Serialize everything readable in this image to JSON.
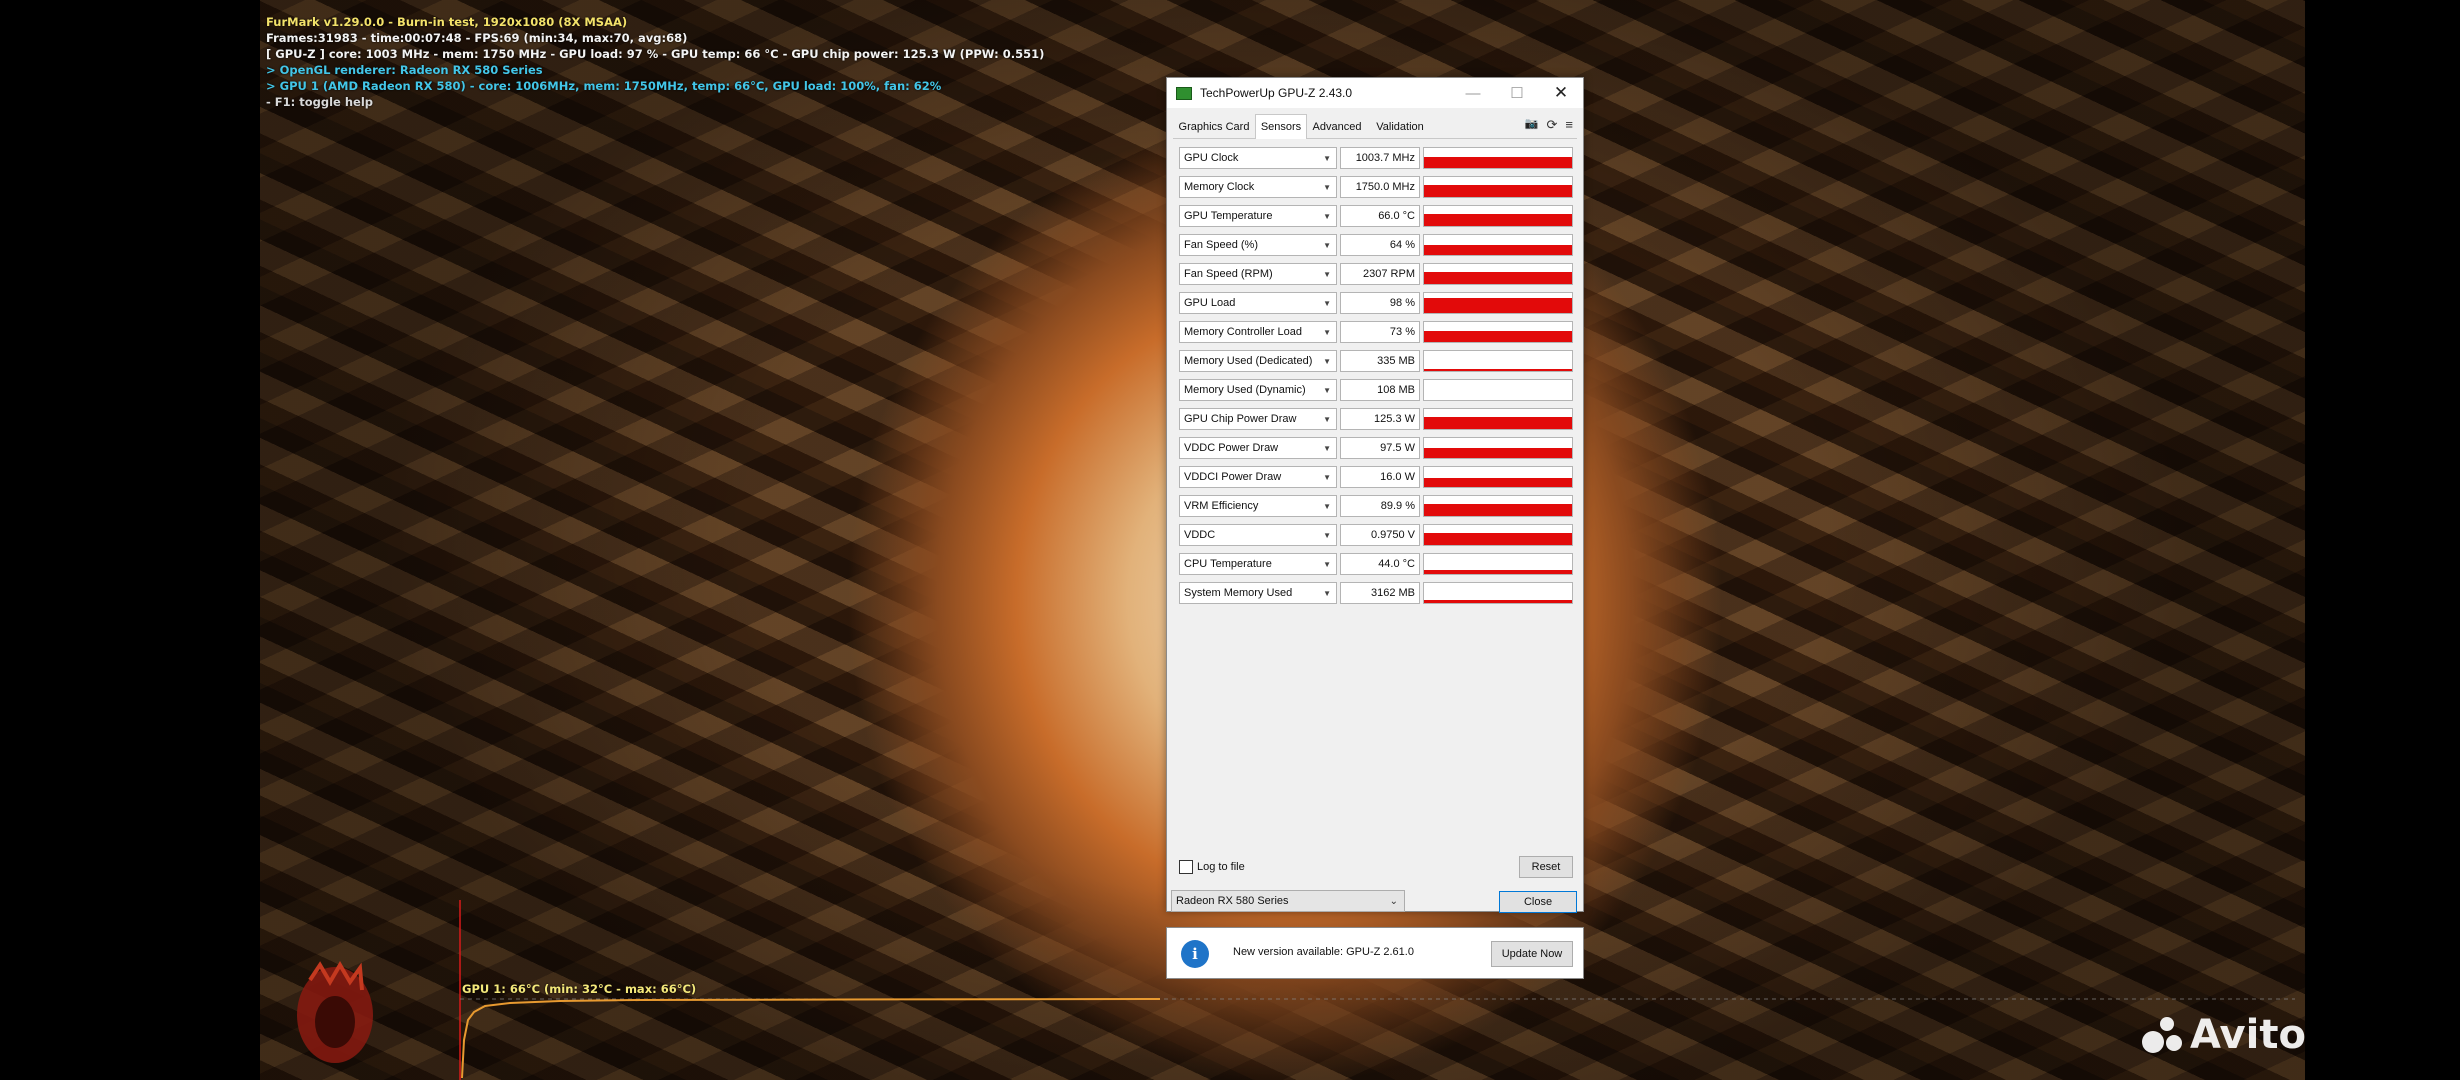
{
  "furmark": {
    "line1": "FurMark v1.29.0.0 - Burn-in test, 1920x1080 (8X MSAA)",
    "line2": "Frames:31983 - time:00:07:48 - FPS:69 (min:34, max:70, avg:68)",
    "line3": "[ GPU-Z ] core: 1003 MHz - mem: 1750 MHz - GPU load: 97 % - GPU temp: 66 °C - GPU chip power: 125.3 W (PPW: 0.551)",
    "line4": "> OpenGL renderer: Radeon RX 580 Series",
    "line5": "> GPU 1 (AMD Radeon RX 580) - core: 1006MHz, mem: 1750MHz, temp: 66°C, GPU load: 100%, fan: 62%",
    "line6": "- F1: toggle help",
    "graph_label": "GPU 1: 66°C (min: 32°C - max: 66°C)"
  },
  "gpuz": {
    "title": "TechPowerUp GPU-Z 2.43.0",
    "min_glyph": "—",
    "max_glyph": "☐",
    "close_glyph": "✕",
    "tabs": [
      {
        "label": "Graphics Card"
      },
      {
        "label": "Sensors"
      },
      {
        "label": "Advanced"
      },
      {
        "label": "Validation"
      }
    ],
    "icons": {
      "camera": "📷",
      "refresh": "⟳",
      "menu": "≡"
    },
    "sensors": [
      {
        "name": "GPU Clock",
        "value": "1003.7 MHz",
        "level": 0.55
      },
      {
        "name": "Memory Clock",
        "value": "1750.0 MHz",
        "level": 0.62
      },
      {
        "name": "GPU Temperature",
        "value": "66.0 °C",
        "level": 0.62
      },
      {
        "name": "Fan Speed (%)",
        "value": "64 %",
        "level": 0.5
      },
      {
        "name": "Fan Speed (RPM)",
        "value": "2307 RPM",
        "level": 0.6
      },
      {
        "name": "GPU Load",
        "value": "98 %",
        "level": 0.75
      },
      {
        "name": "Memory Controller Load",
        "value": "73 %",
        "level": 0.55
      },
      {
        "name": "Memory Used (Dedicated)",
        "value": "335 MB",
        "level": 0.08
      },
      {
        "name": "Memory Used (Dynamic)",
        "value": "108 MB",
        "level": 0.0
      },
      {
        "name": "GPU Chip Power Draw",
        "value": "125.3 W",
        "level": 0.6
      },
      {
        "name": "VDDC Power Draw",
        "value": "97.5 W",
        "level": 0.5
      },
      {
        "name": "VDDCI Power Draw",
        "value": "16.0 W",
        "level": 0.45
      },
      {
        "name": "VRM Efficiency",
        "value": "89.9 %",
        "level": 0.6
      },
      {
        "name": "VDDC",
        "value": "0.9750 V",
        "level": 0.6
      },
      {
        "name": "CPU Temperature",
        "value": "44.0 °C",
        "level": 0.2
      },
      {
        "name": "System Memory Used",
        "value": "3162 MB",
        "level": 0.15
      }
    ],
    "log_to_file": "Log to file",
    "reset_label": "Reset",
    "close_label": "Close",
    "gpu_select": "Radeon RX 580 Series"
  },
  "update": {
    "icon_glyph": "i",
    "message": "New version available: GPU-Z 2.61.0",
    "button": "Update Now"
  },
  "watermark": "Avito"
}
